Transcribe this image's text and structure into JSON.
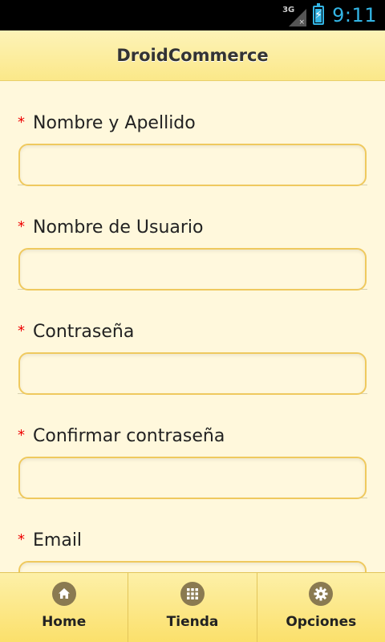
{
  "status_bar": {
    "network_label": "3G",
    "network_status": "×",
    "time": "9:11",
    "accent_color": "#33b5e5"
  },
  "header": {
    "title": "DroidCommerce"
  },
  "form": {
    "required_marker": "*",
    "fields": [
      {
        "label": "Nombre y Apellido",
        "value": ""
      },
      {
        "label": "Nombre de Usuario",
        "value": ""
      },
      {
        "label": "Contraseña",
        "value": ""
      },
      {
        "label": "Confirmar contraseña",
        "value": ""
      },
      {
        "label": "Email",
        "value": ""
      }
    ]
  },
  "bottom_nav": {
    "items": [
      {
        "label": "Home",
        "icon": "home-icon"
      },
      {
        "label": "Tienda",
        "icon": "grid-icon"
      },
      {
        "label": "Opciones",
        "icon": "gear-icon"
      }
    ]
  },
  "colors": {
    "background": "#fff8dc",
    "header_bar": "#fbe889",
    "input_border": "#efc95e",
    "required_marker": "#e00000"
  }
}
